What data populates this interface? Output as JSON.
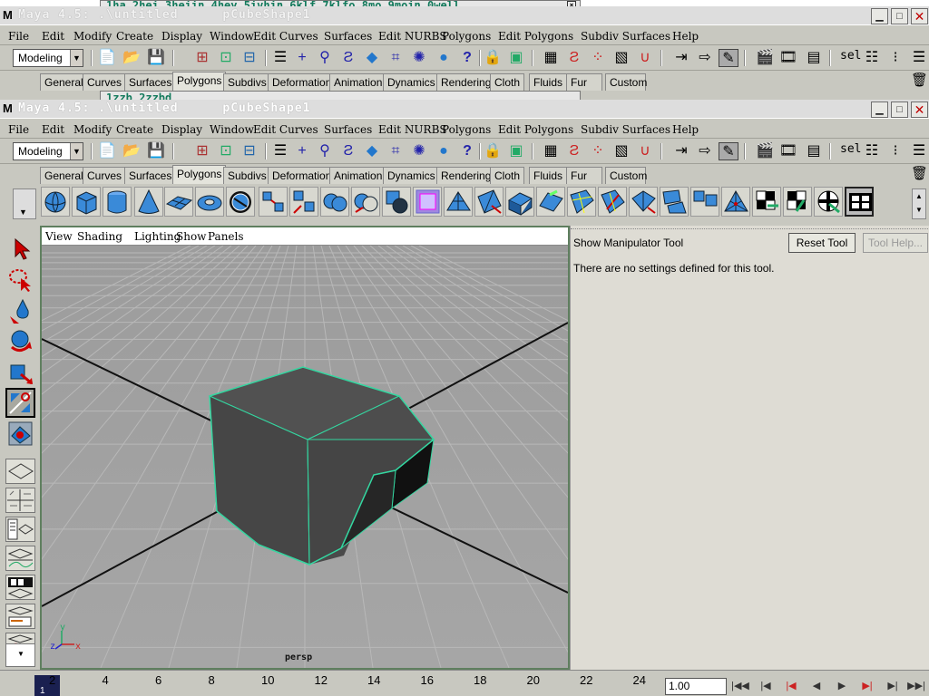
{
  "ghost": {
    "hotkey_hint": "1ha 2hei 3heiin 4hey 5ivhin 6klf 7klfo 8mo 9moin 0well",
    "help_hint": "1zzb 2zzbd"
  },
  "window": {
    "title_prefix": "Maya 4.5:",
    "title_path": ".\\untitled",
    "title_object": "pCubeShape1"
  },
  "menus": [
    "File",
    "Edit",
    "Modify",
    "Create",
    "Display",
    "Window",
    "Edit Curves",
    "Surfaces",
    "Edit NURBS",
    "Polygons",
    "Edit Polygons",
    "Subdiv Surfaces",
    "Help"
  ],
  "status_line": {
    "mode": "Modeling",
    "sel_label": "sel"
  },
  "shelf_tabs": [
    "General",
    "Curves",
    "Surfaces",
    "Polygons",
    "Subdivs",
    "Deformation",
    "Animation",
    "Dynamics",
    "Rendering",
    "Cloth",
    "Fluids",
    "Fur",
    "Custom"
  ],
  "active_shelf_tab": "Polygons",
  "viewport": {
    "menu": [
      "View",
      "Shading",
      "Lighting",
      "Show",
      "Panels"
    ],
    "camera": "persp",
    "axis_y": "y",
    "axis_z": "z",
    "axis_x": "x"
  },
  "tool_settings": {
    "title": "Show Manipulator Tool",
    "reset_button": "Reset Tool",
    "help_button": "Tool Help...",
    "message": "There are no settings defined for this tool."
  },
  "timeline": {
    "ticks": [
      "2",
      "4",
      "6",
      "8",
      "10",
      "12",
      "14",
      "16",
      "18",
      "20",
      "22",
      "24"
    ],
    "current_marker": "1",
    "current_frame": "1.00"
  }
}
